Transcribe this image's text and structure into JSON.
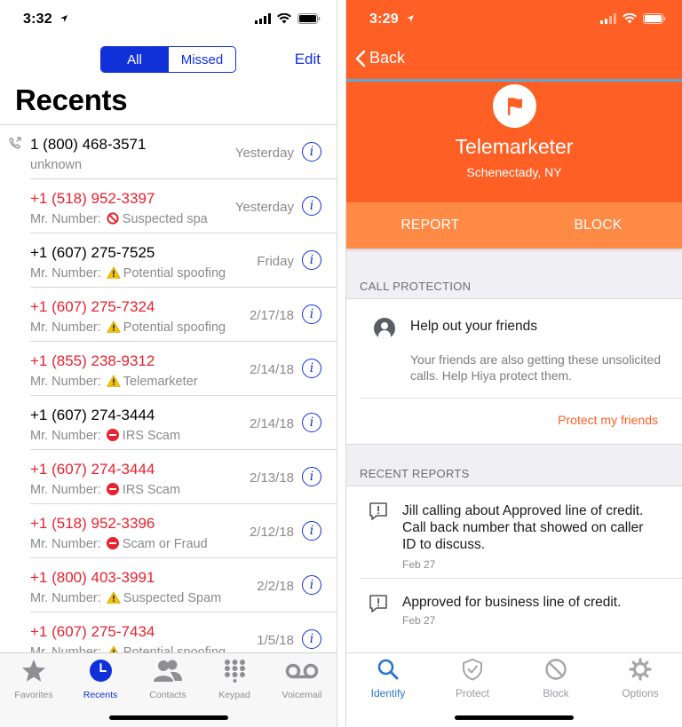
{
  "left": {
    "status_time": "3:32",
    "segments": [
      "All",
      "Missed"
    ],
    "edit_label": "Edit",
    "title": "Recents",
    "calls": [
      {
        "number": "1 (800) 468-3571",
        "sub_prefix": "",
        "sub_icon": "",
        "sub_text": "unknown",
        "date": "Yesterday",
        "missed": false,
        "outgoing": true
      },
      {
        "number": "+1 (518) 952-3397",
        "sub_prefix": "Mr. Number:",
        "sub_icon": "prohibited-icon",
        "sub_text": "Suspected spa",
        "date": "Yesterday",
        "missed": true,
        "outgoing": false
      },
      {
        "number": "+1 (607) 275-7525",
        "sub_prefix": "Mr. Number:",
        "sub_icon": "warning-icon",
        "sub_text": "Potential spoofing",
        "date": "Friday",
        "missed": false,
        "outgoing": false
      },
      {
        "number": "+1 (607) 275-7324",
        "sub_prefix": "Mr. Number:",
        "sub_icon": "warning-icon",
        "sub_text": "Potential spoofing",
        "date": "2/17/18",
        "missed": true,
        "outgoing": false
      },
      {
        "number": "+1 (855) 238-9312",
        "sub_prefix": "Mr. Number:",
        "sub_icon": "warning-icon",
        "sub_text": "Telemarketer",
        "date": "2/14/18",
        "missed": true,
        "outgoing": false
      },
      {
        "number": "+1 (607) 274-3444",
        "sub_prefix": "Mr. Number:",
        "sub_icon": "no-entry-icon",
        "sub_text": "IRS Scam",
        "date": "2/14/18",
        "missed": false,
        "outgoing": false
      },
      {
        "number": "+1 (607) 274-3444",
        "sub_prefix": "Mr. Number:",
        "sub_icon": "no-entry-icon",
        "sub_text": "IRS Scam",
        "date": "2/13/18",
        "missed": true,
        "outgoing": false
      },
      {
        "number": "+1 (518) 952-3396",
        "sub_prefix": "Mr. Number:",
        "sub_icon": "no-entry-icon",
        "sub_text": "Scam or Fraud",
        "date": "2/12/18",
        "missed": true,
        "outgoing": false
      },
      {
        "number": "+1 (800) 403-3991",
        "sub_prefix": "Mr. Number:",
        "sub_icon": "warning-icon",
        "sub_text": "Suspected Spam",
        "date": "2/2/18",
        "missed": true,
        "outgoing": false
      },
      {
        "number": "+1 (607) 275-7434",
        "sub_prefix": "Mr. Number:",
        "sub_icon": "warning-icon",
        "sub_text": "Potential spoofing",
        "date": "1/5/18",
        "missed": true,
        "outgoing": false
      }
    ],
    "tabs": [
      {
        "label": "Favorites",
        "icon": "star-icon"
      },
      {
        "label": "Recents",
        "icon": "clock-icon"
      },
      {
        "label": "Contacts",
        "icon": "contacts-icon"
      },
      {
        "label": "Keypad",
        "icon": "keypad-icon"
      },
      {
        "label": "Voicemail",
        "icon": "voicemail-icon"
      }
    ]
  },
  "right": {
    "status_time": "3:29",
    "back_label": "Back",
    "caller_title": "Telemarketer",
    "caller_location": "Schenectady, NY",
    "actions": [
      "REPORT",
      "BLOCK"
    ],
    "call_protection": {
      "header": "CALL PROTECTION",
      "title": "Help out your friends",
      "body": "Your friends are also getting these unsolicited calls. Help Hiya protect them.",
      "link": "Protect my friends"
    },
    "recent_reports": {
      "header": "RECENT REPORTS",
      "items": [
        {
          "text": "Jill calling about Approved line of credit. Call back number that showed on caller ID to discuss.",
          "date": "Feb 27"
        },
        {
          "text": "Approved for business line of credit.",
          "date": "Feb 27"
        }
      ]
    },
    "tabs": [
      {
        "label": "Identify",
        "icon": "search-icon"
      },
      {
        "label": "Protect",
        "icon": "shield-icon"
      },
      {
        "label": "Block",
        "icon": "block-icon"
      },
      {
        "label": "Options",
        "icon": "gear-icon"
      }
    ]
  },
  "colors": {
    "ios_blue": "#1030d8",
    "missed_red": "#e8222f",
    "hiya_orange": "#fe5f24",
    "hiya_action": "#ff8a46",
    "hiya_tab_active": "#2a77c9"
  }
}
